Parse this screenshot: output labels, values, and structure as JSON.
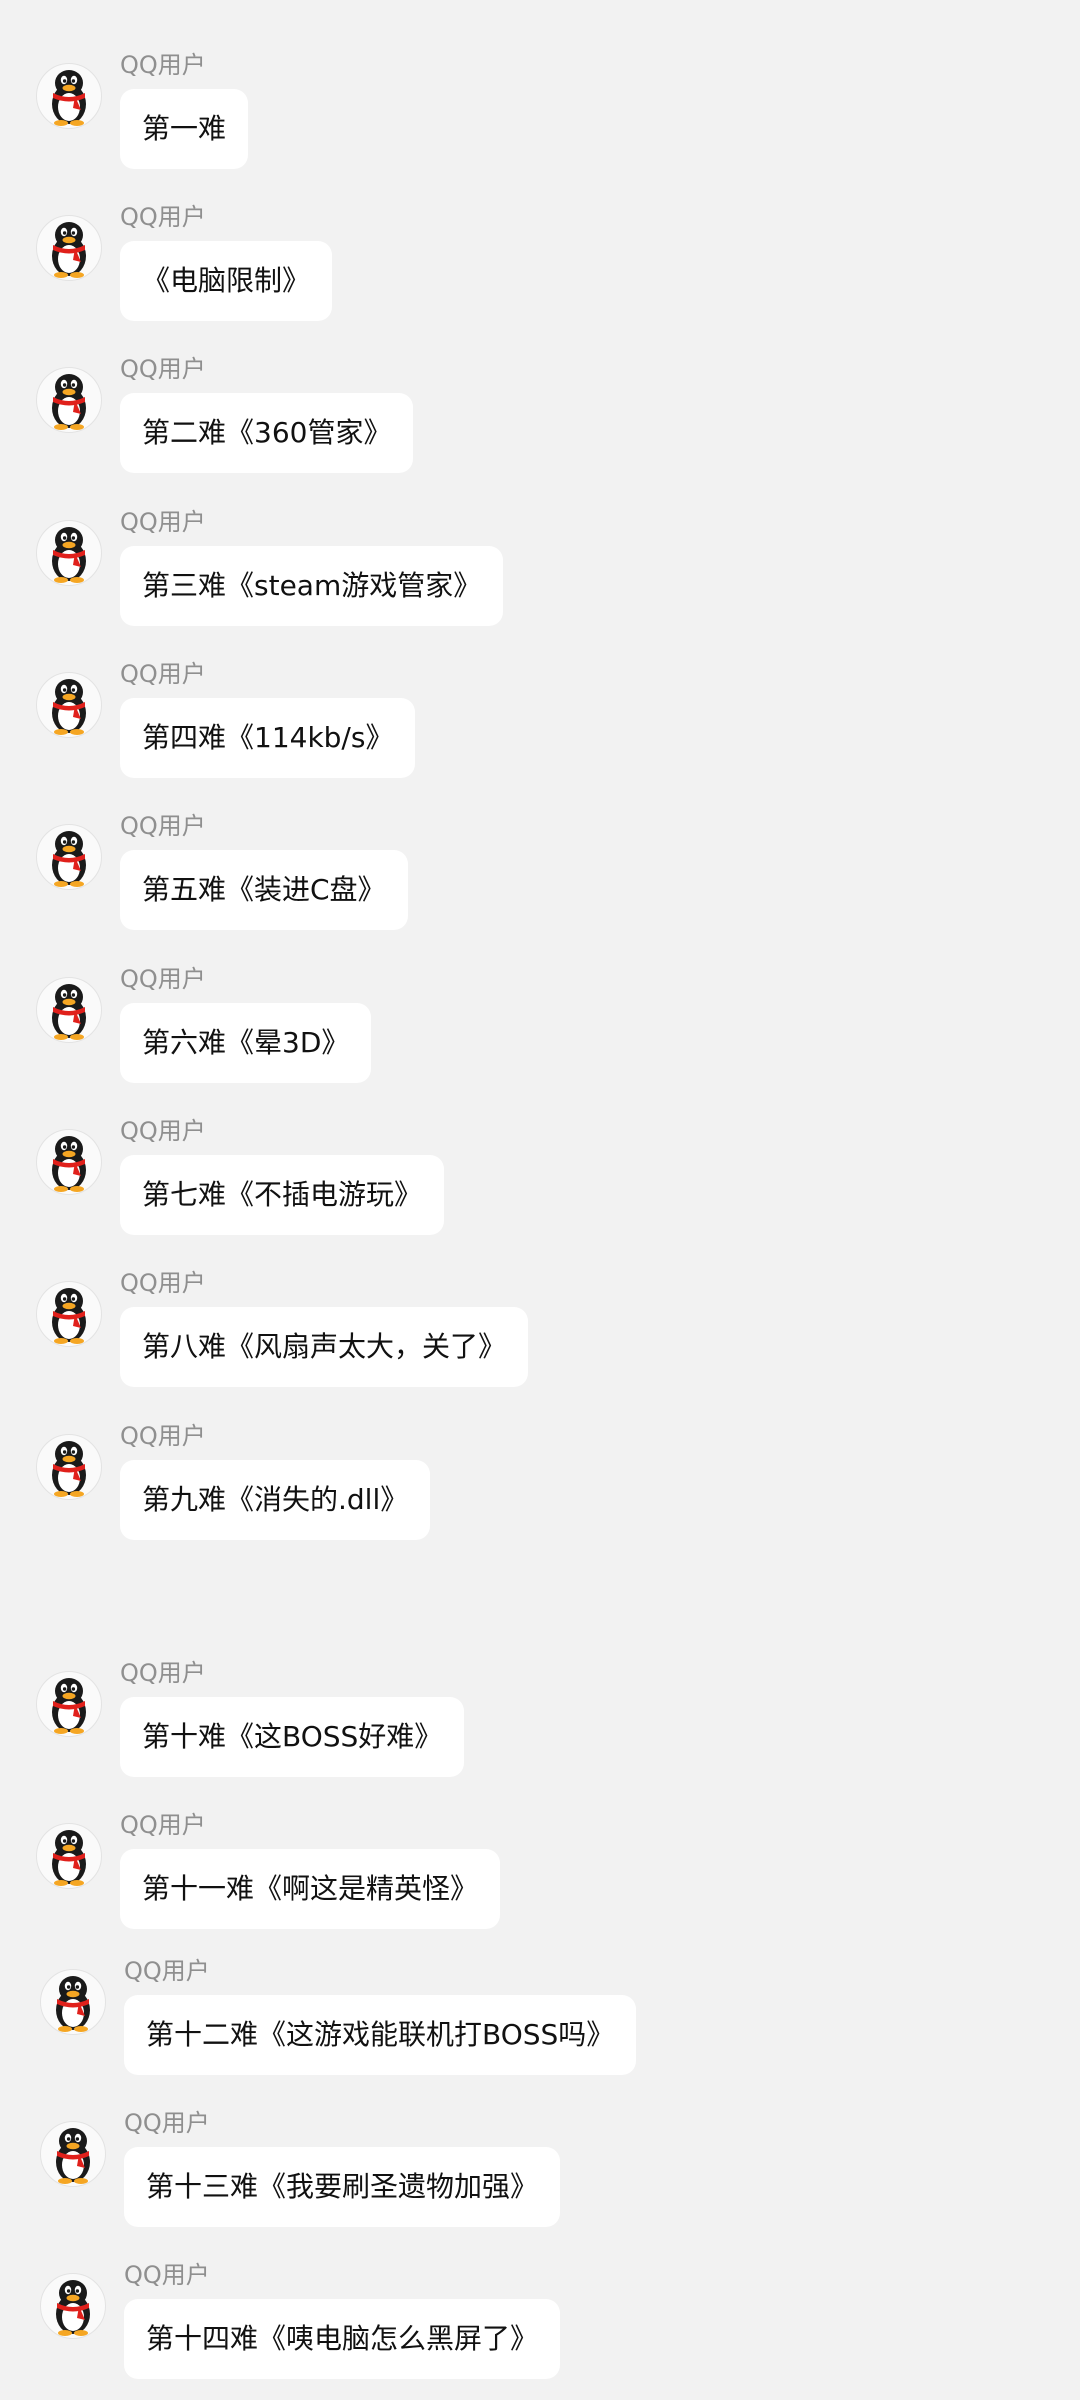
{
  "chat": {
    "sender_name": "QQ用户",
    "avatar_icon": "qq-penguin-icon",
    "messages": [
      {
        "sender": "QQ用户",
        "text": "第一难"
      },
      {
        "sender": "QQ用户",
        "text": "《电脑限制》"
      },
      {
        "sender": "QQ用户",
        "text": "第二难《360管家》"
      },
      {
        "sender": "QQ用户",
        "text": "第三难《steam游戏管家》"
      },
      {
        "sender": "QQ用户",
        "text": "第四难《114kb/s》"
      },
      {
        "sender": "QQ用户",
        "text": "第五难《装进C盘》"
      },
      {
        "sender": "QQ用户",
        "text": "第六难《晕3D》"
      },
      {
        "sender": "QQ用户",
        "text": "第七难《不插电游玩》"
      },
      {
        "sender": "QQ用户",
        "text": "第八难《风扇声太大，关了》"
      },
      {
        "sender": "QQ用户",
        "text": "第九难《消失的.dll》"
      },
      {
        "sender": "QQ用户",
        "text": "第十难《这BOSS好难》"
      },
      {
        "sender": "QQ用户",
        "text": "第十一难《啊这是精英怪》"
      },
      {
        "sender": "QQ用户",
        "text": "第十二难《这游戏能联机打BOSS吗》"
      },
      {
        "sender": "QQ用户",
        "text": "第十三难《我要刷圣遗物加强》"
      },
      {
        "sender": "QQ用户",
        "text": "第十四难《咦电脑怎么黑屏了》"
      }
    ]
  },
  "colors": {
    "background": "#f2f2f2",
    "bubble": "#ffffff",
    "sender_text": "#8f8f8f",
    "message_text": "#111111",
    "penguin_scarf": "#e0201b",
    "penguin_beak": "#f5a623"
  }
}
